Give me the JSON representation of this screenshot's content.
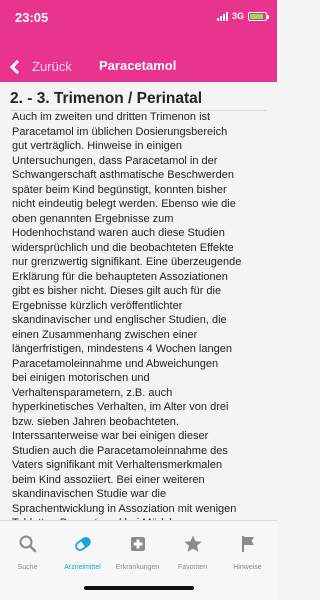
{
  "status_bar": {
    "time": "23:05",
    "network": "3G"
  },
  "nav": {
    "back_label": "Zurück",
    "title": "Paracetamol"
  },
  "section": {
    "title": "2. - 3. Trimenon / Perinatal",
    "body": "Auch im zweiten und dritten Trimenon ist\nParacetamol im üblichen Dosierungsbereich\ngut verträglich. Hinweise in einigen\nUntersuchungen, dass Paracetamol in der\nSchwangerschaft asthmatische Beschwerden\nspäter beim Kind begünstigt, konnten bisher\nnicht eindeutig belegt werden. Ebenso wie die\noben genannten Ergebnisse zum\nHodenhochstand waren auch diese Studien\nwidersprüchlich und die beobachteten Effekte\nnur grenzwertig signifikant. Eine überzeugende\nErklärung für die behaupteten Assoziationen\ngibt es bisher nicht. Dieses gilt auch für die\nErgebnisse kürzlich veröffentlichter\nskandinavischer und englischer Studien, die\neinen Zusammenhang zwischen einer\nlängerfristigen, mindestens 4 Wochen langen\nParacetamoleinnahme und Abweichungen\nbei einigen motorischen und\nVerhaltensparametern, z.B. auch\nhyperkinetisches Verhalten, im Alter von drei\nbzw. sieben Jahren beobachteten.\nInterssanterweise war bei einigen dieser\nStudien auch die Paracetamoleinnahme des\nVaters signifikant mit Verhaltensmerkmalen\nbeim Kind assoziiert. Bei einer weiteren\nskandinavischen Studie war die\nSprachentwicklung in Assoziation mit wenigen\nTabletten Paracetamol bei Mädchen"
  },
  "tabs": [
    {
      "label": "Suche",
      "icon": "search-icon",
      "active": false
    },
    {
      "label": "Arzneimittel",
      "icon": "pill-icon",
      "active": true
    },
    {
      "label": "Erkrankungen",
      "icon": "medical-cross-icon",
      "active": false
    },
    {
      "label": "Favoriten",
      "icon": "star-icon",
      "active": false
    },
    {
      "label": "Hinweise",
      "icon": "flag-icon",
      "active": false
    }
  ],
  "colors": {
    "header": "#e8338f",
    "active_tab": "#16a7d7",
    "inactive_tab": "#8b8b8b"
  }
}
